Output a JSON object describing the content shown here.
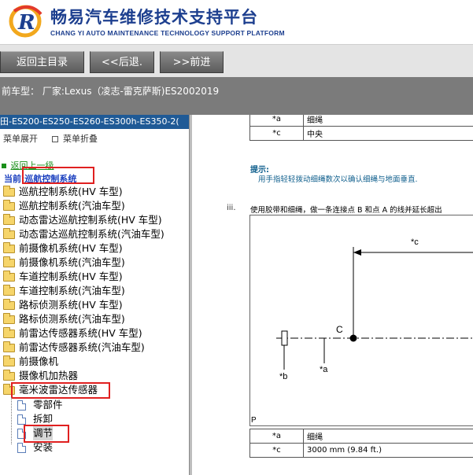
{
  "header": {
    "title": "畅易汽车维修技术支持平台",
    "subtitle": "CHANG YI AUTO MAINTENANCE TECHNOLOGY SUPPORT PLATFORM",
    "brand_color": "#1d3f8f",
    "logo_icon": "cy-logo-icon"
  },
  "toolbar": {
    "home_label": "返回主目录",
    "back_label": "<<后退.",
    "forward_label": ">>前进"
  },
  "vehicle": {
    "text": "前车型：  厂家:Lexus（凌志-雷克萨斯)ES2002019"
  },
  "tree": {
    "title": "田-ES200-ES250-ES260-ES300h-ES350-2(",
    "expand_label": "菜单展开",
    "collapse_label": "菜单折叠",
    "back_link": "返回上一级",
    "current_prefix": "当前:",
    "current_name": "巡航控制系统",
    "items": [
      {
        "label": "巡航控制系统(HV 车型)"
      },
      {
        "label": "巡航控制系统(汽油车型)"
      },
      {
        "label": "动态雷达巡航控制系统(HV 车型)"
      },
      {
        "label": "动态雷达巡航控制系统(汽油车型)"
      },
      {
        "label": "前摄像机系统(HV 车型)"
      },
      {
        "label": "前摄像机系统(汽油车型)"
      },
      {
        "label": "车道控制系统(HV 车型)"
      },
      {
        "label": "车道控制系统(汽油车型)"
      },
      {
        "label": "路标侦测系统(HV 车型)"
      },
      {
        "label": "路标侦测系统(汽油车型)"
      },
      {
        "label": "前雷达传感器系统(HV 车型)"
      },
      {
        "label": "前雷达传感器系统(汽油车型)"
      },
      {
        "label": "前摄像机"
      },
      {
        "label": "摄像机加热器"
      },
      {
        "label": "毫米波雷达传感器"
      }
    ],
    "sub_items": [
      {
        "label": "零部件"
      },
      {
        "label": "拆卸"
      },
      {
        "label": "调节"
      },
      {
        "label": "安装"
      }
    ],
    "highlight_color": "#e02020"
  },
  "content": {
    "top_table": [
      {
        "key": "*a",
        "value": "细绳"
      },
      {
        "key": "*c",
        "value": "中央"
      }
    ],
    "hint_title": "提示:",
    "hint_text": "用手指轻轻拨动细绳数次以确认细绳与地面垂直.",
    "step_num": "iii.",
    "step_text": "使用胶带和细绳，做一条连接点 B 和点 A 的线并延长超出",
    "figure": {
      "label_c_dim": "*c",
      "label_C": "C",
      "label_b": "*b",
      "label_a": "*a",
      "label_P": "P"
    },
    "bottom_table": [
      {
        "key": "*a",
        "value": "细绳"
      },
      {
        "key": "*c",
        "value": "3000 mm (9.84 ft.)"
      }
    ]
  }
}
